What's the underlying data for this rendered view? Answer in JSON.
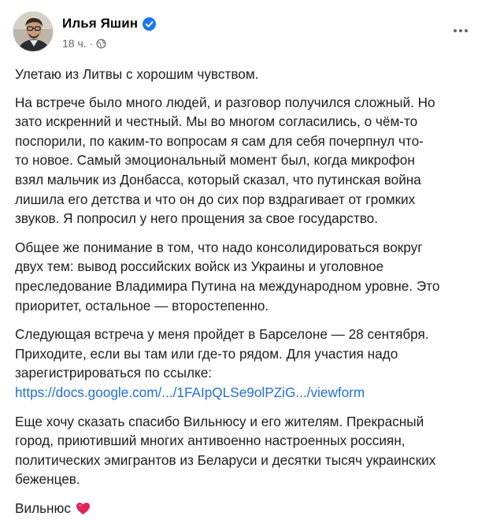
{
  "post": {
    "author": {
      "name": "Илья Яшин",
      "verified": true
    },
    "meta": {
      "time": "18 ч.",
      "separator": "·",
      "audience_icon": "globe-icon"
    },
    "more_icon": "more-options-icon",
    "paragraphs": [
      "Улетаю из Литвы с хорошим чувством.",
      "На встрече было много людей, и разговор получился сложный. Но\nзато искренний и честный. Мы во многом согласились, о чём-то\nпоспорили, по каким-то вопросам я сам для себя почерпнул что-\nто новое. Самый эмоциональный момент был, когда микрофон\nвзял мальчик из Донбасса, который сказал, что путинская война\nлишила его детства и что он до сих пор вздрагивает от громких\nзвуков. Я попросил у него прощения за свое государство.",
      "Общее же понимание в том, что надо консолидироваться вокруг\nдвух тем: вывод российских войск из Украины и уголовное\nпреследование Владимира Путина на международном уровне. Это\nприоритет, остальное — второстепенно.",
      "Следующая встреча у меня пройдет в Барселоне — 28 сентября.\nПриходите, если вы там или где-то рядом. Для участия надо\nзарегистрироваться по ссылке:",
      "Еще хочу сказать спасибо Вильнюсу и его жителям. Прекрасный\nгород, приютивший многих антивоенно настроенных россиян,\nполитических эмигрантов из Беларуси и десятки тысяч украинских\nбеженцев."
    ],
    "link_text": "https://docs.google.com/.../1FAIpQLSe9olPZiG.../viewform",
    "closing": "Вильнюс",
    "closing_emoji": "heart-icon"
  },
  "colors": {
    "link": "#216fdb",
    "verified": "#1877f2",
    "heart": "#e0245e",
    "meta": "#65676b"
  }
}
